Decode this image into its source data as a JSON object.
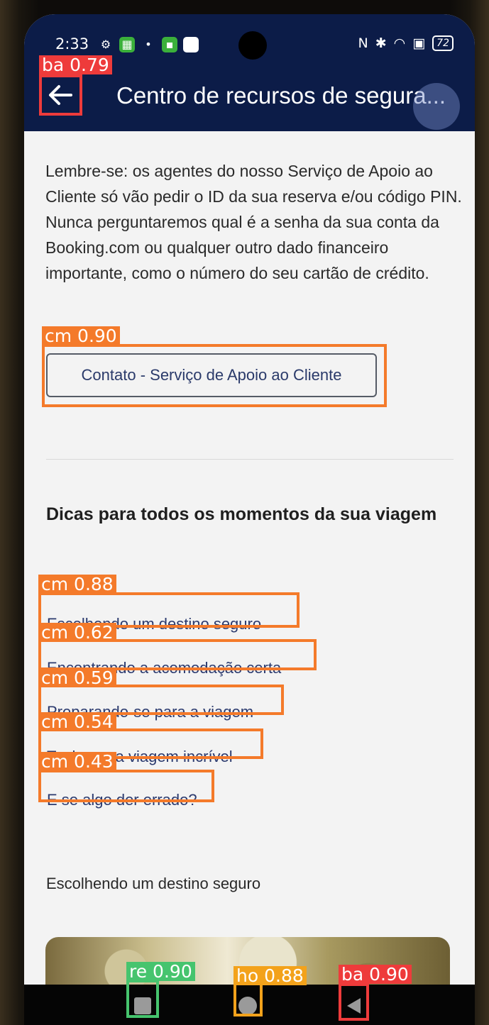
{
  "status_bar": {
    "time": "2:33",
    "battery": "72"
  },
  "app_bar": {
    "back_icon": "arrow-left-icon",
    "title": "Centro de recursos de segura..."
  },
  "main": {
    "notice": "Lembre-se: os agentes do nosso Serviço de Apoio ao Cliente só vão pedir o ID da sua reserva e/ou código PIN. Nunca perguntaremos qual é a senha da sua conta da Booking.com ou qualquer outro dado financeiro importante, como o número do seu cartão de crédito.",
    "contact_button": "Contato - Serviço de Apoio ao Cliente",
    "tips_heading": "Dicas para todos os momentos da sua viagem",
    "tips": [
      "Escolhendo um destino seguro",
      "Encontrando a acomodação certa",
      "Preparando-se para a viagem",
      "Tenha uma viagem incrível",
      "E se algo der errado?"
    ],
    "section_title": "Escolhendo um destino seguro"
  },
  "nav_bar": {
    "recents_icon": "square-icon",
    "home_icon": "circle-icon",
    "back_icon": "triangle-back-icon"
  },
  "detections": [
    {
      "label": "ba 0.79",
      "color": "#ee3b3b"
    },
    {
      "label": "cm 0.90",
      "color": "#f47a2a"
    },
    {
      "label": "cm 0.88",
      "color": "#f47a2a"
    },
    {
      "label": "cm 0.62",
      "color": "#f47a2a"
    },
    {
      "label": "cm 0.59",
      "color": "#f47a2a"
    },
    {
      "label": "cm 0.54",
      "color": "#f47a2a"
    },
    {
      "label": "cm 0.43",
      "color": "#f47a2a"
    },
    {
      "label": "re 0.90",
      "color": "#46c46e"
    },
    {
      "label": "ho 0.88",
      "color": "#f3a21b"
    },
    {
      "label": "ba 0.90",
      "color": "#ee3b3b"
    }
  ]
}
